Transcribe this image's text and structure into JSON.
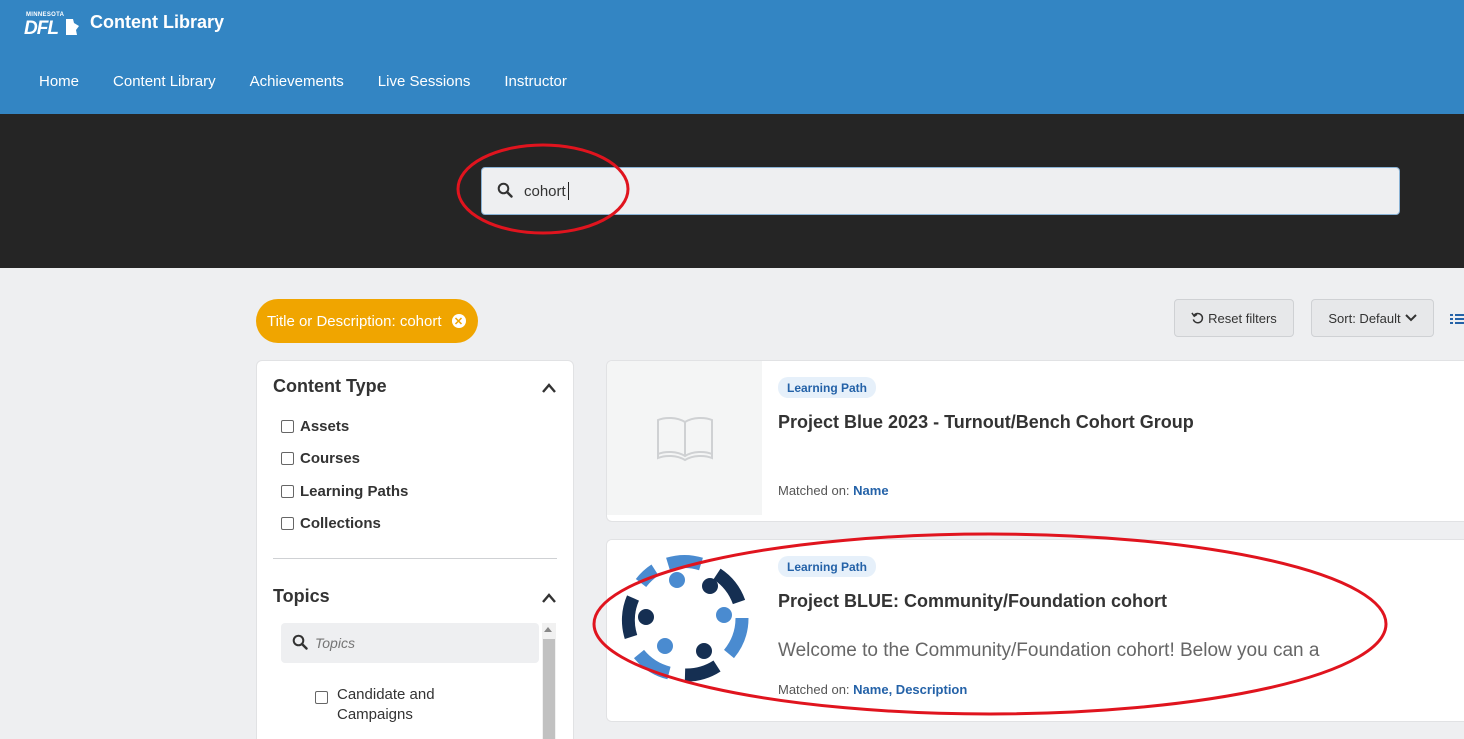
{
  "header": {
    "logo_top": "MINNESOTA",
    "logo_main": "DFL",
    "app_title": "Content Library",
    "nav": [
      {
        "label": "Home"
      },
      {
        "label": "Content Library"
      },
      {
        "label": "Achievements"
      },
      {
        "label": "Live Sessions"
      },
      {
        "label": "Instructor"
      }
    ]
  },
  "search": {
    "value": "cohort",
    "icon": "search-icon"
  },
  "filters": {
    "chip_label": "Title or Description: cohort",
    "reset_label": "Reset filters",
    "sort_label": "Sort: Default"
  },
  "sidebar": {
    "content_type": {
      "heading": "Content Type",
      "options": [
        {
          "label": "Assets",
          "checked": false
        },
        {
          "label": "Courses",
          "checked": false
        },
        {
          "label": "Learning Paths",
          "checked": false
        },
        {
          "label": "Collections",
          "checked": false
        }
      ]
    },
    "topics": {
      "heading": "Topics",
      "search_placeholder": "Topics",
      "options": [
        {
          "label": "Candidate and Campaigns",
          "checked": false
        }
      ]
    }
  },
  "results": [
    {
      "badge": "Learning Path",
      "title": "Project Blue 2023 - Turnout/Bench Cohort Group",
      "description": "",
      "matched_prefix": "Matched on:",
      "matched_fields": "Name",
      "thumbnail": "book-icon"
    },
    {
      "badge": "Learning Path",
      "title": "Project BLUE: Community/Foundation cohort",
      "description": "Welcome to the Community/Foundation cohort! Below you can a",
      "matched_prefix": "Matched on:",
      "matched_fields": "Name, Description",
      "thumbnail": "community-circle-logo"
    }
  ],
  "colors": {
    "header_blue": "#3385c3",
    "search_band": "#252525",
    "chip_orange": "#f0a500",
    "link_blue": "#2462a8",
    "annotation_red": "#e0141e"
  }
}
